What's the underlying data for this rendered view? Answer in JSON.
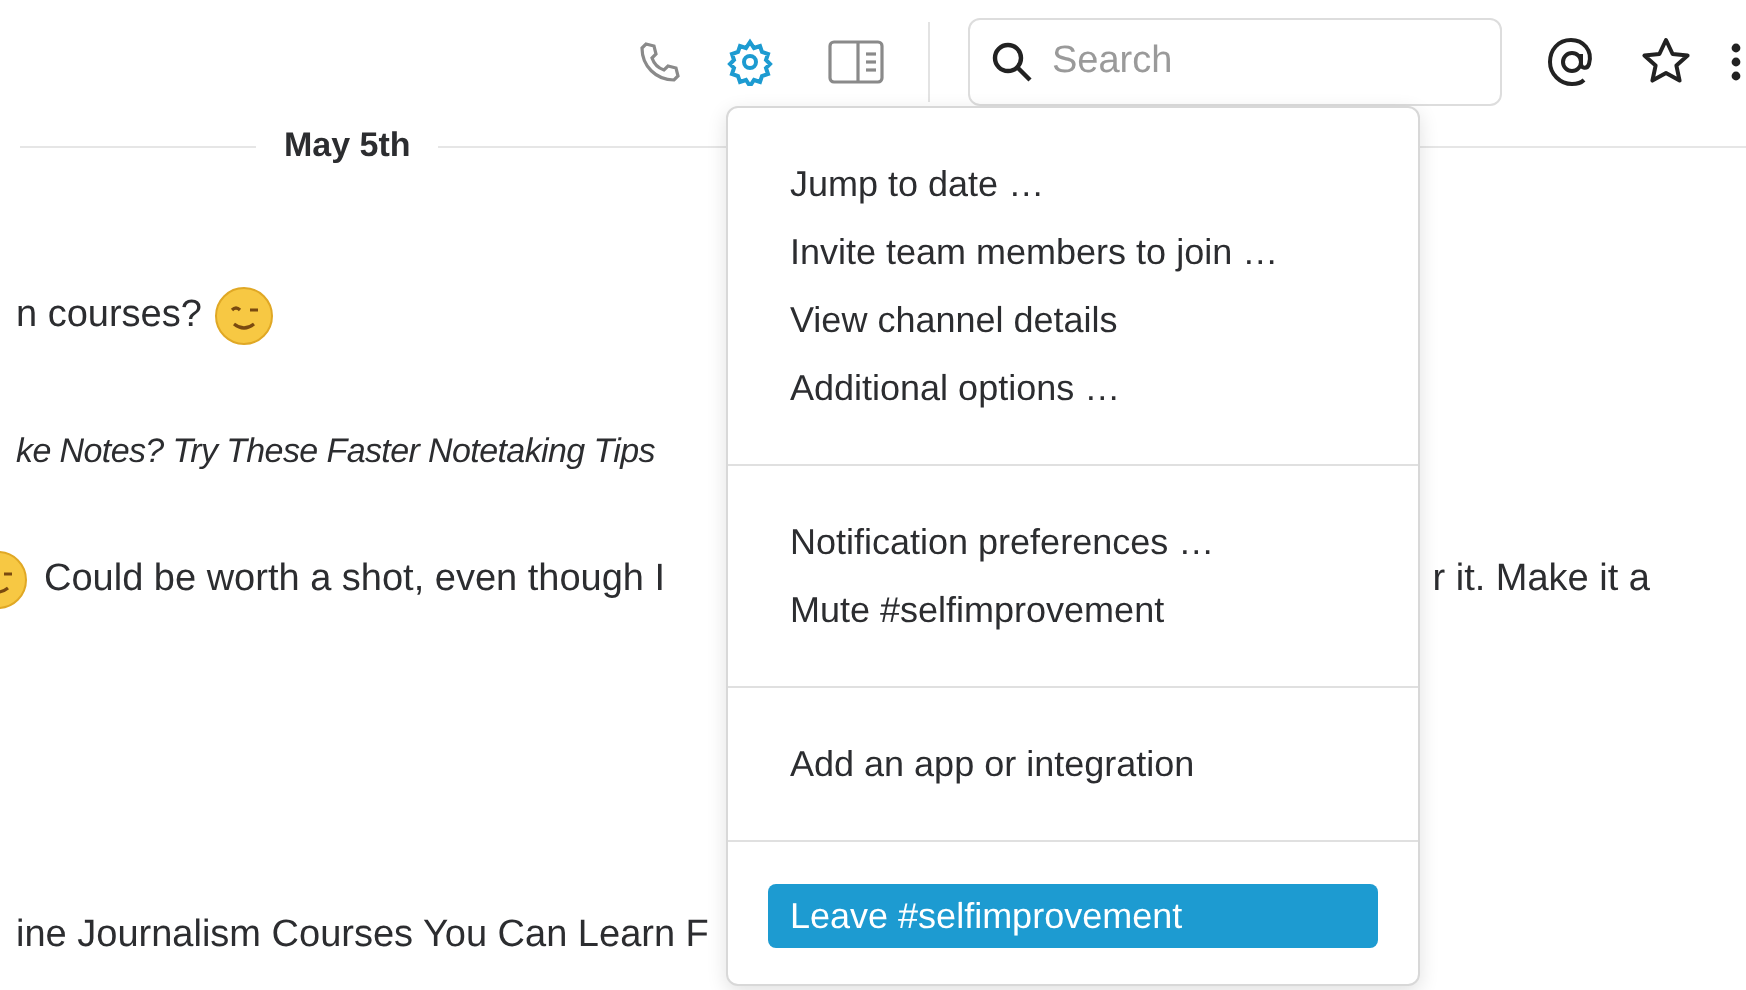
{
  "toolbar": {
    "icons": [
      {
        "kind": "phone",
        "selected": false
      },
      {
        "kind": "gear",
        "selected": true
      },
      {
        "kind": "panel",
        "selected": false
      }
    ]
  },
  "search": {
    "placeholder": "Search"
  },
  "actions": [
    {
      "kind": "at"
    },
    {
      "kind": "star"
    },
    {
      "kind": "more"
    }
  ],
  "date_divider": "May 5th",
  "messages": [
    {
      "kind": "plain",
      "text": "n courses?",
      "emoji_after": true
    },
    {
      "kind": "italic",
      "text": "ke Notes? Try These Faster Notetaking Tips"
    },
    {
      "kind": "plain",
      "text": "Could be worth a shot, even though I",
      "text_right": "r it. Make it a",
      "emoji_before": true
    },
    {
      "kind": "plain",
      "text": "ine Journalism Courses You Can Learn F"
    }
  ],
  "menu": {
    "sections": [
      [
        {
          "label": "Jump to date …",
          "selected": false
        },
        {
          "label": "Invite team members to join …",
          "selected": false
        },
        {
          "label": "View channel details",
          "selected": false
        },
        {
          "label": "Additional options …",
          "selected": false
        }
      ],
      [
        {
          "label": "Notification preferences …",
          "selected": false
        },
        {
          "label": "Mute #selfimprovement",
          "selected": false
        }
      ],
      [
        {
          "label": "Add an app or integration",
          "selected": false
        }
      ],
      [
        {
          "label": "Leave #selfimprovement",
          "selected": true
        }
      ]
    ]
  }
}
